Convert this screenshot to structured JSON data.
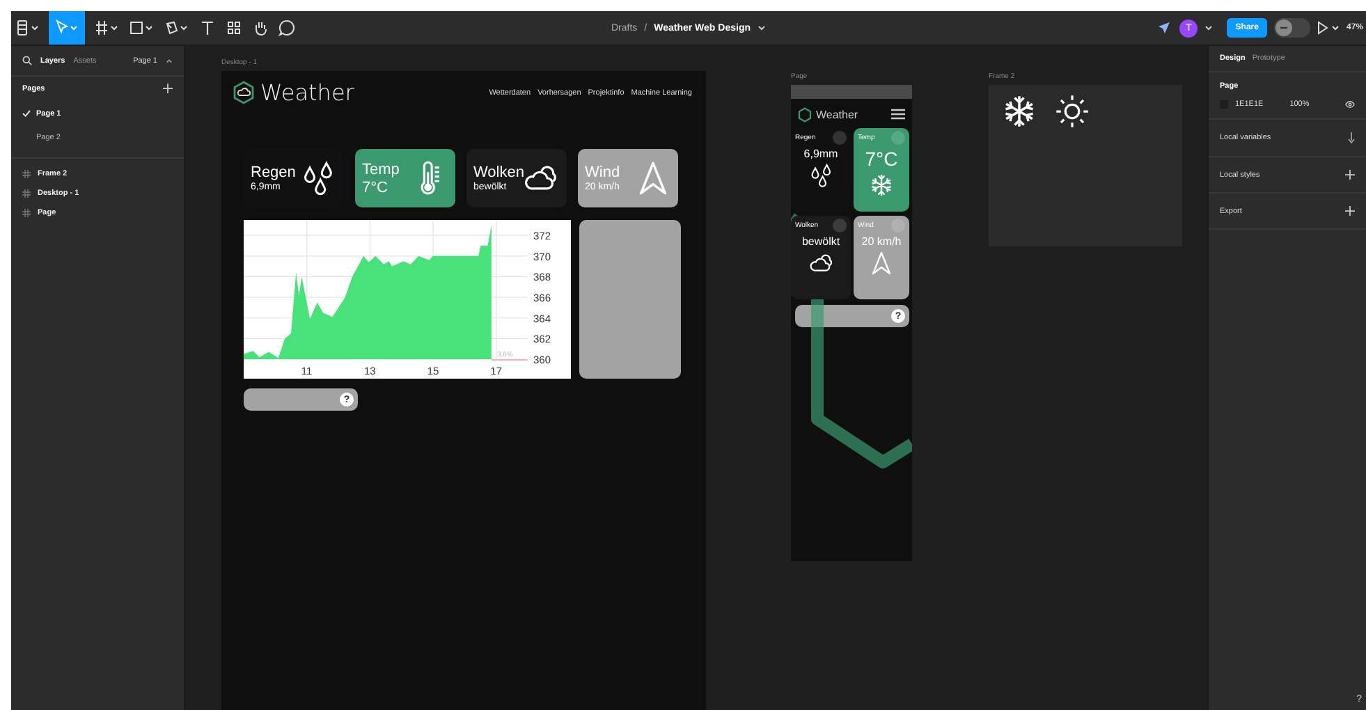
{
  "toolbar": {
    "breadcrumb_folder": "Drafts",
    "breadcrumb_separator": "/",
    "file_name": "Weather Web Design",
    "avatar": "T",
    "share": "Share",
    "zoom": "47%"
  },
  "left_panel": {
    "tabs": [
      {
        "label": "Layers",
        "selected": true
      },
      {
        "label": "Assets",
        "selected": false
      }
    ],
    "page_picker": "Page 1",
    "pages_heading": "Pages",
    "pages": [
      {
        "label": "Page 1",
        "selected": true
      },
      {
        "label": "Page 2",
        "selected": false
      }
    ],
    "layers": [
      "Frame 2",
      "Desktop - 1",
      "Page"
    ]
  },
  "desktop_frame": {
    "label": "Desktop - 1",
    "logo": "Weather",
    "nav": [
      "Wetterdaten",
      "Vorhersagen",
      "Projektinfo",
      "Machine Learning"
    ],
    "cards": [
      {
        "kind": "rain",
        "title": "Regen",
        "value": "6,9mm",
        "color": "#111111"
      },
      {
        "kind": "temperature",
        "title": "Temp",
        "value": "7°C",
        "color": "#3a9a6e"
      },
      {
        "kind": "clouds",
        "title": "Wolken",
        "value": "bewölkt",
        "color": "#1b1b1b"
      },
      {
        "kind": "wind",
        "title": "Wind",
        "value": "20 km/h",
        "color": "#a3a3a3"
      }
    ],
    "chart": {
      "chart_data": {
        "type": "area",
        "x": [
          9.0,
          9.3,
          9.5,
          9.8,
          10.0,
          10.1,
          10.3,
          10.5,
          10.66,
          10.75,
          10.84,
          11.1,
          11.33,
          11.52,
          11.81,
          12.21,
          12.44,
          12.8,
          12.96,
          13.18,
          13.44,
          13.6,
          13.7,
          14.07,
          14.29,
          14.54,
          14.88,
          14.99,
          16.44,
          16.51,
          16.73,
          16.85
        ],
        "series": [
          {
            "color": "#48e27a",
            "values": [
              360.5,
              360.8,
              360.2,
              360.7,
              360.3,
              360.1,
              362.0,
              362.5,
              368.4,
              366.2,
              368.0,
              363.9,
              365.5,
              364.5,
              364.1,
              366.0,
              368.0,
              370.0,
              369.4,
              370.0,
              369.2,
              369.5,
              369.0,
              369.5,
              369.2,
              370.0,
              369.6,
              370.0,
              370.0,
              371.0,
              371.0,
              373.0
            ]
          }
        ],
        "xlim": [
          9,
          18
        ],
        "ylim": [
          360,
          373.5
        ],
        "xticks": [
          11,
          13,
          15,
          17
        ],
        "yticks": [
          360,
          362,
          364,
          366,
          368,
          370,
          372
        ],
        "grid": true,
        "annotations": [
          "3,6%"
        ]
      }
    },
    "question_bar": "?"
  },
  "mobile_frame": {
    "label": "Page",
    "logo": "Weather",
    "cards": [
      {
        "kind": "rain",
        "title": "Regen",
        "value": "6,9mm",
        "color": "#111111"
      },
      {
        "kind": "snow",
        "title": "Temp",
        "value": "7°C",
        "color": "#3a9a6e"
      },
      {
        "kind": "clouds",
        "title": "Wolken",
        "value": "bewölkt",
        "color": "#1b1b1b"
      },
      {
        "kind": "wind",
        "title": "Wind",
        "value": "20 km/h",
        "color": "#a3a3a3"
      }
    ],
    "question_bar": "?"
  },
  "icon_frame": {
    "label": "Frame 2"
  },
  "right_panel": {
    "tabs": [
      {
        "label": "Design",
        "selected": true
      },
      {
        "label": "Prototype",
        "selected": false
      }
    ],
    "page_heading": "Page",
    "background_hex": "1E1E1E",
    "background_opacity": "100%",
    "sections": [
      "Local variables",
      "Local styles",
      "Export"
    ],
    "help": "?"
  }
}
